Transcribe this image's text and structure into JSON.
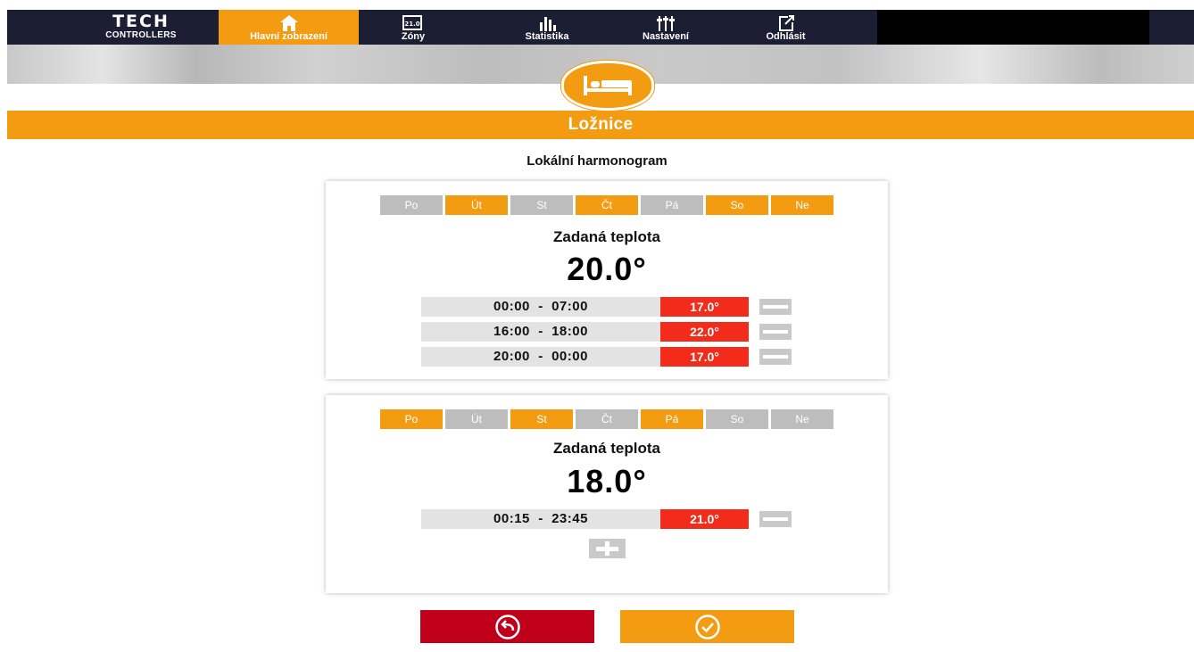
{
  "logo": {
    "brand": "TECH",
    "sub": "CONTROLLERS"
  },
  "nav": [
    {
      "label": "Hlavní zobrazení",
      "icon": "home-icon",
      "active": true
    },
    {
      "label": "Zóny",
      "icon": "zones-display-icon",
      "icon_text": "21.0"
    },
    {
      "label": "Statistika",
      "icon": "bar-chart-icon"
    },
    {
      "label": "Nastavení",
      "icon": "sliders-icon"
    },
    {
      "label": "Odhlásit",
      "icon": "logout-icon"
    }
  ],
  "zone": {
    "name": "Ložnice",
    "icon": "bed-icon"
  },
  "schedule_title": "Lokální harmonogram",
  "cards": [
    {
      "days": [
        {
          "label": "Po",
          "on": false
        },
        {
          "label": "Út",
          "on": true
        },
        {
          "label": "St",
          "on": false
        },
        {
          "label": "Čt",
          "on": true
        },
        {
          "label": "Pá",
          "on": false
        },
        {
          "label": "So",
          "on": true
        },
        {
          "label": "Ne",
          "on": true
        }
      ],
      "set_label": "Zadaná teplota",
      "set_value": "20.0°",
      "intervals": [
        {
          "from": "00:00",
          "to": "07:00",
          "temp": "17.0°"
        },
        {
          "from": "16:00",
          "to": "18:00",
          "temp": "22.0°"
        },
        {
          "from": "20:00",
          "to": "00:00",
          "temp": "17.0°"
        }
      ]
    },
    {
      "days": [
        {
          "label": "Po",
          "on": true
        },
        {
          "label": "Út",
          "on": false
        },
        {
          "label": "St",
          "on": true
        },
        {
          "label": "Čt",
          "on": false
        },
        {
          "label": "Pá",
          "on": true
        },
        {
          "label": "So",
          "on": false
        },
        {
          "label": "Ne",
          "on": false
        }
      ],
      "set_label": "Zadaná teplota",
      "set_value": "18.0°",
      "intervals": [
        {
          "from": "00:15",
          "to": "23:45",
          "temp": "21.0°"
        }
      ]
    }
  ],
  "buttons": {
    "back_icon": "undo-arrow-icon",
    "confirm_icon": "checkmark-circle-icon"
  },
  "colors": {
    "accent": "#f39c12",
    "nav_bg": "#1c1f33",
    "temp_red": "#f22b1a",
    "back_red": "#c0001a",
    "day_off": "#bdbdbd"
  }
}
